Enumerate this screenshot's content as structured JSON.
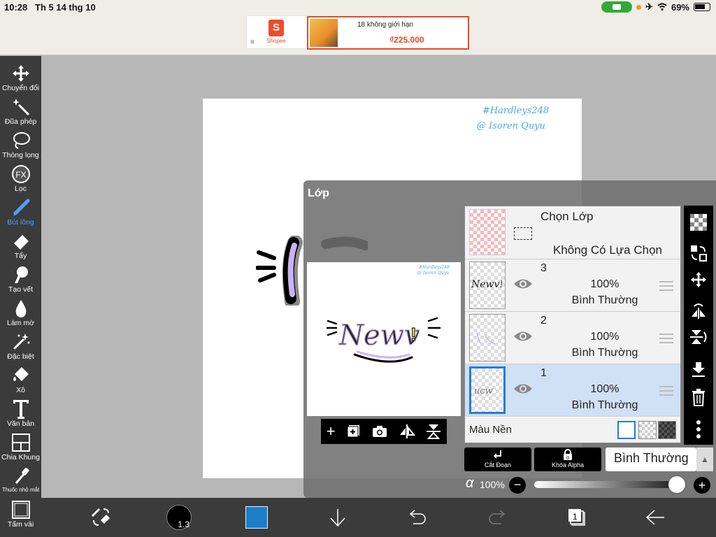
{
  "status": {
    "time": "10:28",
    "date": "Th 5 14 thg 10",
    "battery": "69%"
  },
  "ad": {
    "brand": "Shopee",
    "product_name": "18 không giới hạn",
    "price": "₫225.000"
  },
  "tools": [
    {
      "label": "Chuyển đổi",
      "icon": "move-icon"
    },
    {
      "label": "Đũa phép",
      "icon": "magic-wand-icon"
    },
    {
      "label": "Thòng lọng",
      "icon": "lasso-icon"
    },
    {
      "label": "Lọc",
      "icon": "fx-icon"
    },
    {
      "label": "Bút lông",
      "icon": "brush-icon"
    },
    {
      "label": "Tẩy",
      "icon": "eraser-icon"
    },
    {
      "label": "Tạo vết",
      "icon": "smudge-icon"
    },
    {
      "label": "Làm mờ",
      "icon": "blur-icon"
    },
    {
      "label": "Đặc biệt",
      "icon": "special-icon"
    },
    {
      "label": "Xô",
      "icon": "bucket-icon"
    },
    {
      "label": "Văn bản",
      "icon": "text-icon"
    },
    {
      "label": "Chia Khung",
      "icon": "frame-divider-icon"
    },
    {
      "label": "Thuốc nhỏ mắt",
      "icon": "eyedropper-icon"
    },
    {
      "label": "Tấm vải",
      "icon": "canvas-icon"
    }
  ],
  "canvas": {
    "signature_line1": "#Hardleys248",
    "signature_line2": "@ Isoren Quyu"
  },
  "layers_panel": {
    "title": "Lớp",
    "selection": {
      "title": "Chọn Lớp",
      "subtitle": "Không Có Lựa Chọn"
    },
    "layers": [
      {
        "number": "3",
        "opacity": "100%",
        "mode": "Bình Thường",
        "selected": false
      },
      {
        "number": "2",
        "opacity": "100%",
        "mode": "Bình Thường",
        "selected": false
      },
      {
        "number": "1",
        "opacity": "100%",
        "mode": "Bình Thường",
        "selected": true
      }
    ],
    "background_label": "Màu Nền",
    "clip_label": "Cắt Đoạn",
    "alpha_lock_label": "Khóa Alpha",
    "blend_mode": "Bình Thường",
    "alpha_symbol": "α",
    "opacity": "100%",
    "opacity_value": 1.0
  },
  "bottom": {
    "brush_size": "1.3",
    "color": "#1a7fc9",
    "page_count": "1"
  },
  "colors": {
    "accent": "#1f7de0",
    "active_tool": "#4aa3ff"
  }
}
